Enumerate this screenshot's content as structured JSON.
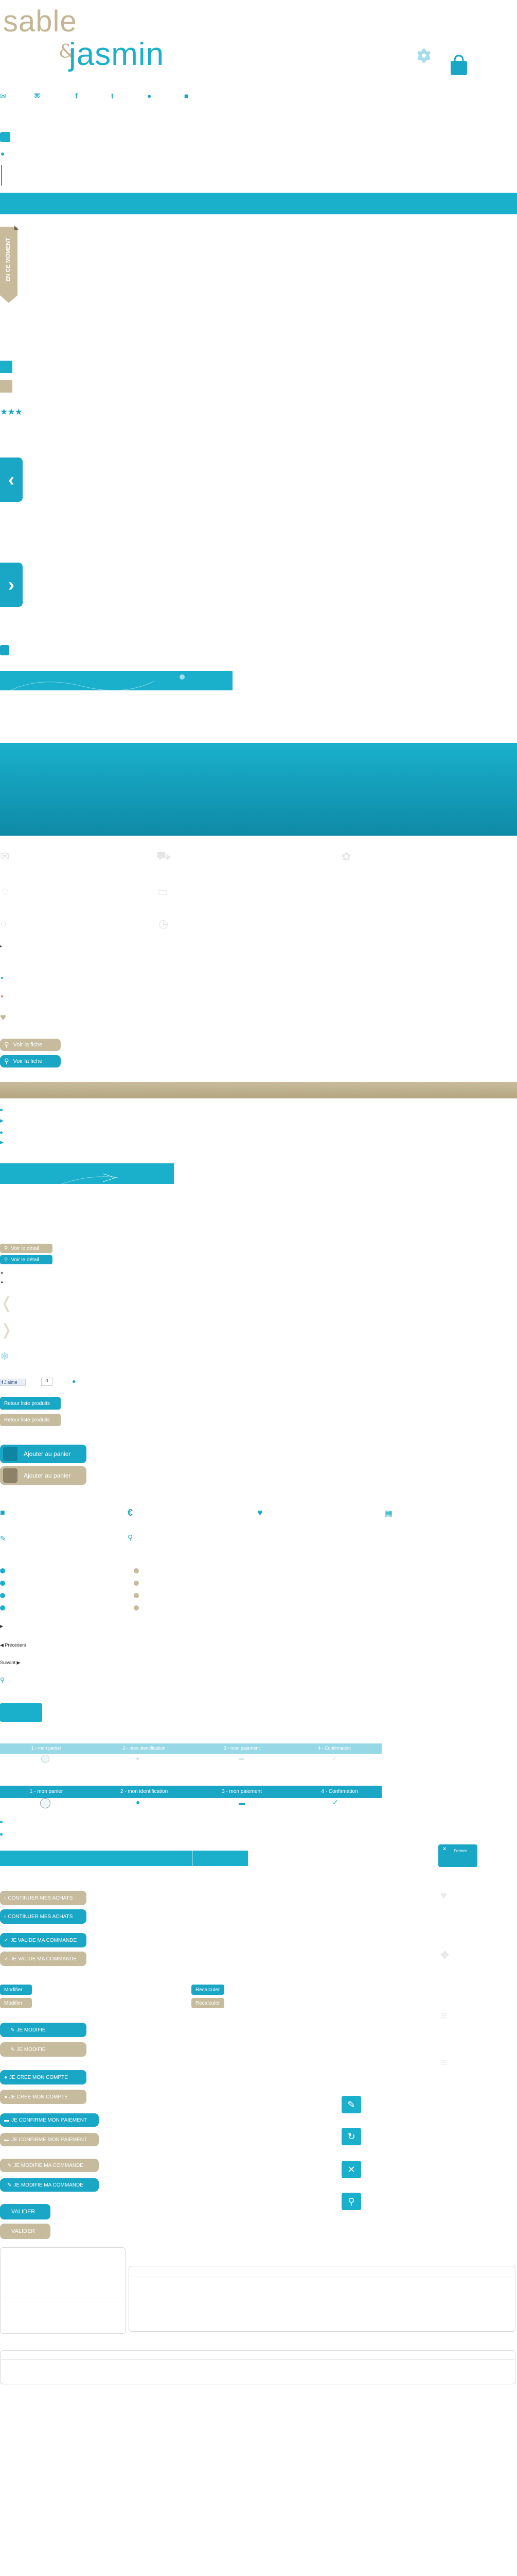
{
  "logo": {
    "line1": "sable",
    "amp": "&",
    "line2": "jasmin"
  },
  "colors": {
    "teal": "#1ab0cc",
    "teal_dark": "#0e8aa6",
    "sand": "#c8bb9c",
    "sand_dark": "#b5a67f"
  },
  "header_icons": [
    "mail-icon",
    "gift-icon",
    "facebook-icon",
    "twitter-icon",
    "user-icon",
    "lock-icon"
  ],
  "sticker": {
    "label": "EN CE MOMENT"
  },
  "buttons": {
    "voir_fiche_1": "Voir la fiche",
    "voir_fiche_2": "Voir la fiche",
    "voir_detail_1": "Voir le détail",
    "voir_detail_2": "Voir le détail",
    "retour_produits_1": "Retour liste produits",
    "retour_produits_2": "Retour liste produits",
    "ajouter_panier_1": "Ajouter au panier",
    "ajouter_panier_2": "Ajouter au panier",
    "continuer_achats_1": "CONTINUER MES ACHATS",
    "continuer_achats_2": "CONTINUER MES ACHATS",
    "valide_commande_1": "JE VALIDE MA COMMANDE",
    "valide_commande_2": "JE VALIDE MA COMMANDE",
    "modifier_1": "Modifier",
    "modifier_2": "Modifier",
    "recalculer_1": "Recalculer",
    "recalculer_2": "Recalculer",
    "modifie_1": "JE MODIFIE",
    "modifie_2": "JE MODIFIE",
    "cree_compte_1": "JE CREE MON COMPTE",
    "cree_compte_2": "JE CREE MON COMPTE",
    "confirme_paiement_1": "JE CONFIRME MON PAIEMENT",
    "confirme_paiement_2": "JE CONFIRME MON PAIEMENT",
    "modifie_commande_1": "JE MODIFIE MA COMMANDE",
    "modifie_commande_2": "JE MODIFIE MA COMMANDE",
    "valider_1": "VALIDER",
    "valider_2": "VALIDER",
    "close": "Fermer"
  },
  "pagination": {
    "prev": "Précédent",
    "next": "Suivant"
  },
  "steps": [
    "1 - mon panier",
    "2 - mon identification",
    "3 - mon paiement",
    "4 - Confirmation"
  ],
  "facebook": {
    "like": "J'aime",
    "count": "0"
  }
}
